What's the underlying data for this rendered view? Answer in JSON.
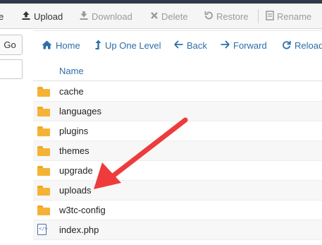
{
  "toolbar": {
    "items": [
      {
        "label": "e",
        "icon": "",
        "state": "enabled"
      },
      {
        "label": "Upload",
        "icon": "upload-icon",
        "state": "enabled"
      },
      {
        "label": "Download",
        "icon": "download-icon",
        "state": "disabled"
      },
      {
        "label": "Delete",
        "icon": "delete-icon",
        "state": "disabled"
      },
      {
        "label": "Restore",
        "icon": "restore-icon",
        "state": "disabled"
      },
      {
        "label": "Rename",
        "icon": "rename-icon",
        "state": "disabled"
      }
    ]
  },
  "left_panel": {
    "go_label": "Go"
  },
  "nav": {
    "home": "Home",
    "up": "Up One Level",
    "back": "Back",
    "forward": "Forward",
    "reload": "Reload"
  },
  "list": {
    "column_name": "Name",
    "rows": [
      {
        "name": "cache",
        "type": "folder"
      },
      {
        "name": "languages",
        "type": "folder"
      },
      {
        "name": "plugins",
        "type": "folder"
      },
      {
        "name": "themes",
        "type": "folder"
      },
      {
        "name": "upgrade",
        "type": "folder"
      },
      {
        "name": "uploads",
        "type": "folder"
      },
      {
        "name": "w3tc-config",
        "type": "folder"
      },
      {
        "name": "index.php",
        "type": "file"
      }
    ]
  },
  "colors": {
    "link": "#2d6ea8",
    "folder": "#f5b335",
    "annotation_arrow": "#ee3b3b",
    "disabled_text": "#9a9a9a"
  }
}
